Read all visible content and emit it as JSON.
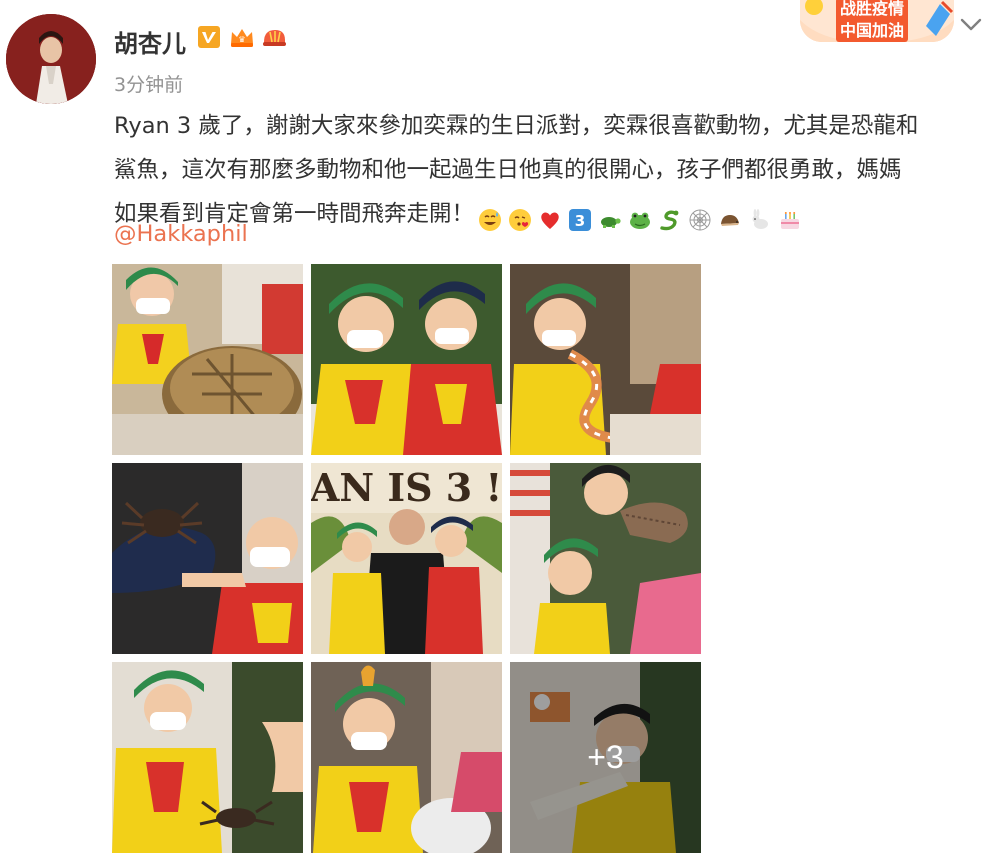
{
  "post": {
    "author": "胡杏儿",
    "timestamp": "3分钟前",
    "campaign_badge": {
      "line1": "战胜疫情",
      "line2": "中国加油"
    },
    "text_lines": [
      "Ryan 3 歲了，謝謝大家來參加奕霖的生日派對，奕霖很喜歡動物，尤其是恐龍和",
      "鯊魚，這次有那麼多動物和他一起過生日他真的很開心，孩子們都很勇敢，媽媽",
      "如果看到肯定會第一時間飛奔走開！"
    ],
    "emojis": [
      "sweat-smile",
      "kiss",
      "red-heart",
      "keycap-3",
      "turtle",
      "frog",
      "snake",
      "spider-web",
      "hedgehog",
      "rabbit",
      "birthday-cake"
    ],
    "mention": "@Hakkaphil",
    "more_count": "+3"
  },
  "photos": [
    {
      "name": "photo-child-with-tortoise"
    },
    {
      "name": "photo-children-with-lizard"
    },
    {
      "name": "photo-child-holding-snake"
    },
    {
      "name": "photo-tarantula-on-cap"
    },
    {
      "name": "photo-ryan-is-3-banner"
    },
    {
      "name": "photo-child-with-bearded-dragon"
    },
    {
      "name": "photo-child-touching-spider"
    },
    {
      "name": "photo-child-with-animal"
    },
    {
      "name": "photo-child-with-bone-toy"
    }
  ],
  "colors": {
    "author": "#333333",
    "timestamp": "#939393",
    "mention": "#eb7350",
    "verified_badge": "#f6a623",
    "campaign_red": "#f35a2f"
  }
}
